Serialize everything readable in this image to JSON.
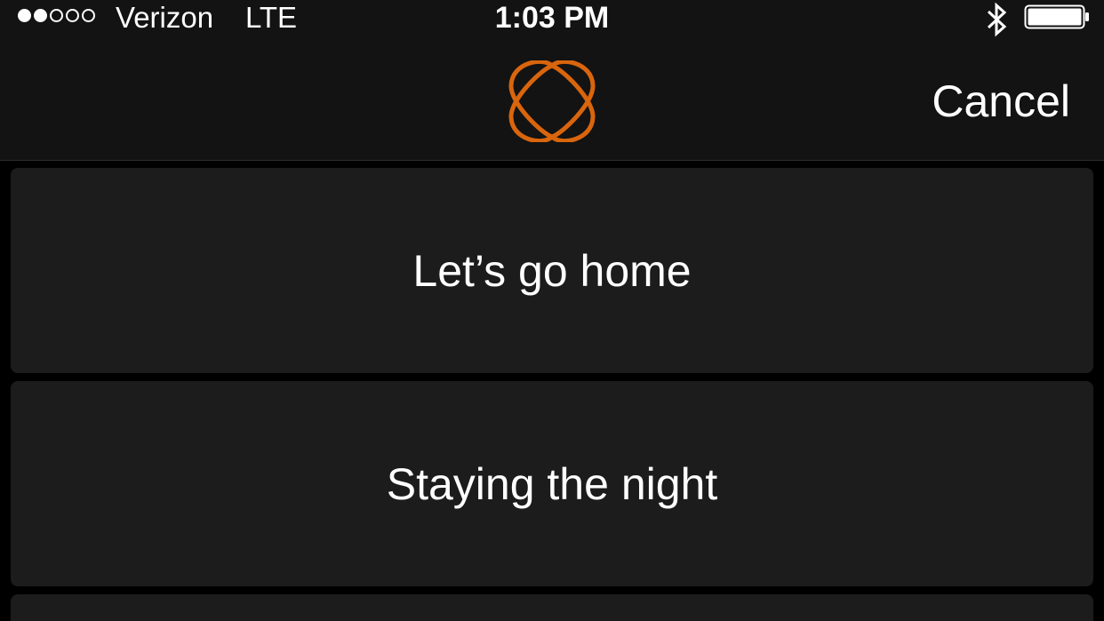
{
  "status_bar": {
    "signal_dots": [
      true,
      true,
      false,
      false,
      false
    ],
    "carrier": "Verizon",
    "network": "LTE",
    "time": "1:03 PM",
    "bluetooth_icon": "bluetooth-icon",
    "battery_icon": "battery-full-icon"
  },
  "nav": {
    "logo_icon": "app-logo-icon",
    "logo_color": "#d9650d",
    "cancel_label": "Cancel"
  },
  "options": [
    {
      "label": "Let’s go home"
    },
    {
      "label": "Staying the night"
    },
    {
      "label": ""
    }
  ]
}
